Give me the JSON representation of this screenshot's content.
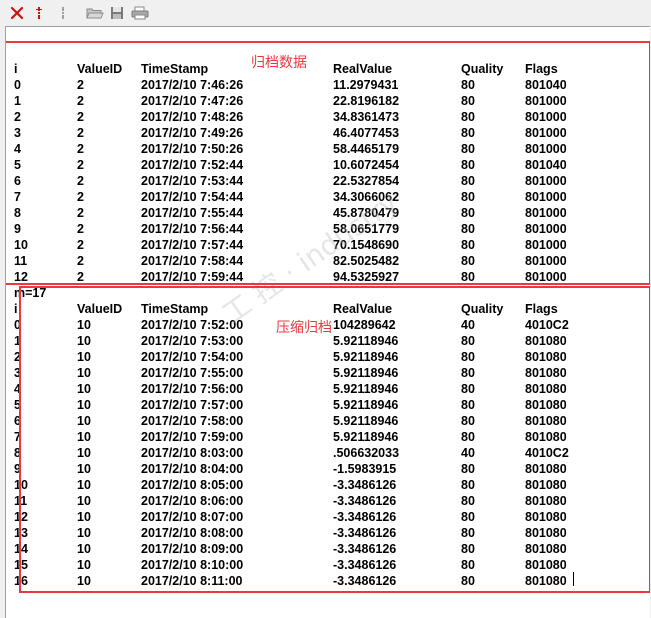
{
  "toolbar": {
    "buttons": [
      {
        "icon": "close-icon",
        "color": "#cc1111"
      },
      {
        "icon": "sort-icon",
        "color": "#cc1111"
      },
      {
        "icon": "sort-disabled-icon",
        "color": "#9a9a9a"
      },
      {
        "icon": "open-folder-icon",
        "color": "#9a9a9a"
      },
      {
        "icon": "save-icon",
        "color": "#808080"
      },
      {
        "icon": "print-icon",
        "color": "#808080"
      }
    ]
  },
  "archive": {
    "annotation": "归档数据",
    "headers": {
      "i": "i",
      "value_id": "ValueID",
      "timestamp": "TimeStamp",
      "real_value": "RealValue",
      "quality": "Quality",
      "flags": "Flags"
    },
    "rows": [
      {
        "i": "0",
        "value_id": "2",
        "timestamp": "2017/2/10 7:46:26",
        "real_value": "11.2979431",
        "quality": "80",
        "flags": "801040"
      },
      {
        "i": "1",
        "value_id": "2",
        "timestamp": "2017/2/10 7:47:26",
        "real_value": "22.8196182",
        "quality": "80",
        "flags": "801000"
      },
      {
        "i": "2",
        "value_id": "2",
        "timestamp": "2017/2/10 7:48:26",
        "real_value": "34.8361473",
        "quality": "80",
        "flags": "801000"
      },
      {
        "i": "3",
        "value_id": "2",
        "timestamp": "2017/2/10 7:49:26",
        "real_value": "46.4077453",
        "quality": "80",
        "flags": "801000"
      },
      {
        "i": "4",
        "value_id": "2",
        "timestamp": "2017/2/10 7:50:26",
        "real_value": "58.4465179",
        "quality": "80",
        "flags": "801000"
      },
      {
        "i": "5",
        "value_id": "2",
        "timestamp": "2017/2/10 7:52:44",
        "real_value": "10.6072454",
        "quality": "80",
        "flags": "801040"
      },
      {
        "i": "6",
        "value_id": "2",
        "timestamp": "2017/2/10 7:53:44",
        "real_value": "22.5327854",
        "quality": "80",
        "flags": "801000"
      },
      {
        "i": "7",
        "value_id": "2",
        "timestamp": "2017/2/10 7:54:44",
        "real_value": "34.3066062",
        "quality": "80",
        "flags": "801000"
      },
      {
        "i": "8",
        "value_id": "2",
        "timestamp": "2017/2/10 7:55:44",
        "real_value": "45.8780479",
        "quality": "80",
        "flags": "801000"
      },
      {
        "i": "9",
        "value_id": "2",
        "timestamp": "2017/2/10 7:56:44",
        "real_value": "58.0651779",
        "quality": "80",
        "flags": "801000"
      },
      {
        "i": "10",
        "value_id": "2",
        "timestamp": "2017/2/10 7:57:44",
        "real_value": "70.1548690",
        "quality": "80",
        "flags": "801000"
      },
      {
        "i": "11",
        "value_id": "2",
        "timestamp": "2017/2/10 7:58:44",
        "real_value": "82.5025482",
        "quality": "80",
        "flags": "801000"
      },
      {
        "i": "12",
        "value_id": "2",
        "timestamp": "2017/2/10 7:59:44",
        "real_value": "94.5325927",
        "quality": "80",
        "flags": "801000"
      }
    ]
  },
  "compressed": {
    "count_label": "m=17",
    "annotation": "压缩归档",
    "headers": {
      "i": "i",
      "value_id": "ValueID",
      "timestamp": "TimeStamp",
      "real_value": "RealValue",
      "quality": "Quality",
      "flags": "Flags"
    },
    "rows": [
      {
        "i": "0",
        "value_id": "10",
        "timestamp": "2017/2/10 7:52:00",
        "real_value": "104289642",
        "quality": "40",
        "flags": "4010C2"
      },
      {
        "i": "1",
        "value_id": "10",
        "timestamp": "2017/2/10 7:53:00",
        "real_value": "5.92118946",
        "quality": "80",
        "flags": "801080"
      },
      {
        "i": "2",
        "value_id": "10",
        "timestamp": "2017/2/10 7:54:00",
        "real_value": "5.92118946",
        "quality": "80",
        "flags": "801080"
      },
      {
        "i": "3",
        "value_id": "10",
        "timestamp": "2017/2/10 7:55:00",
        "real_value": "5.92118946",
        "quality": "80",
        "flags": "801080"
      },
      {
        "i": "4",
        "value_id": "10",
        "timestamp": "2017/2/10 7:56:00",
        "real_value": "5.92118946",
        "quality": "80",
        "flags": "801080"
      },
      {
        "i": "5",
        "value_id": "10",
        "timestamp": "2017/2/10 7:57:00",
        "real_value": "5.92118946",
        "quality": "80",
        "flags": "801080"
      },
      {
        "i": "6",
        "value_id": "10",
        "timestamp": "2017/2/10 7:58:00",
        "real_value": "5.92118946",
        "quality": "80",
        "flags": "801080"
      },
      {
        "i": "7",
        "value_id": "10",
        "timestamp": "2017/2/10 7:59:00",
        "real_value": "5.92118946",
        "quality": "80",
        "flags": "801080"
      },
      {
        "i": "8",
        "value_id": "10",
        "timestamp": "2017/2/10 8:03:00",
        "real_value": ".506632033",
        "quality": "40",
        "flags": "4010C2"
      },
      {
        "i": "9",
        "value_id": "10",
        "timestamp": "2017/2/10 8:04:00",
        "real_value": "-1.5983915",
        "quality": "80",
        "flags": "801080"
      },
      {
        "i": "10",
        "value_id": "10",
        "timestamp": "2017/2/10 8:05:00",
        "real_value": "-3.3486126",
        "quality": "80",
        "flags": "801080"
      },
      {
        "i": "11",
        "value_id": "10",
        "timestamp": "2017/2/10 8:06:00",
        "real_value": "-3.3486126",
        "quality": "80",
        "flags": "801080"
      },
      {
        "i": "12",
        "value_id": "10",
        "timestamp": "2017/2/10 8:07:00",
        "real_value": "-3.3486126",
        "quality": "80",
        "flags": "801080"
      },
      {
        "i": "13",
        "value_id": "10",
        "timestamp": "2017/2/10 8:08:00",
        "real_value": "-3.3486126",
        "quality": "80",
        "flags": "801080"
      },
      {
        "i": "14",
        "value_id": "10",
        "timestamp": "2017/2/10 8:09:00",
        "real_value": "-3.3486126",
        "quality": "80",
        "flags": "801080"
      },
      {
        "i": "15",
        "value_id": "10",
        "timestamp": "2017/2/10 8:10:00",
        "real_value": "-3.3486126",
        "quality": "80",
        "flags": "801080"
      },
      {
        "i": "16",
        "value_id": "10",
        "timestamp": "2017/2/10 8:11:00",
        "real_value": "-3.3486126",
        "quality": "80",
        "flags": "801080"
      }
    ]
  },
  "colors": {
    "annotation": "#e8393e",
    "text": "#000000",
    "background": "#ffffff"
  }
}
